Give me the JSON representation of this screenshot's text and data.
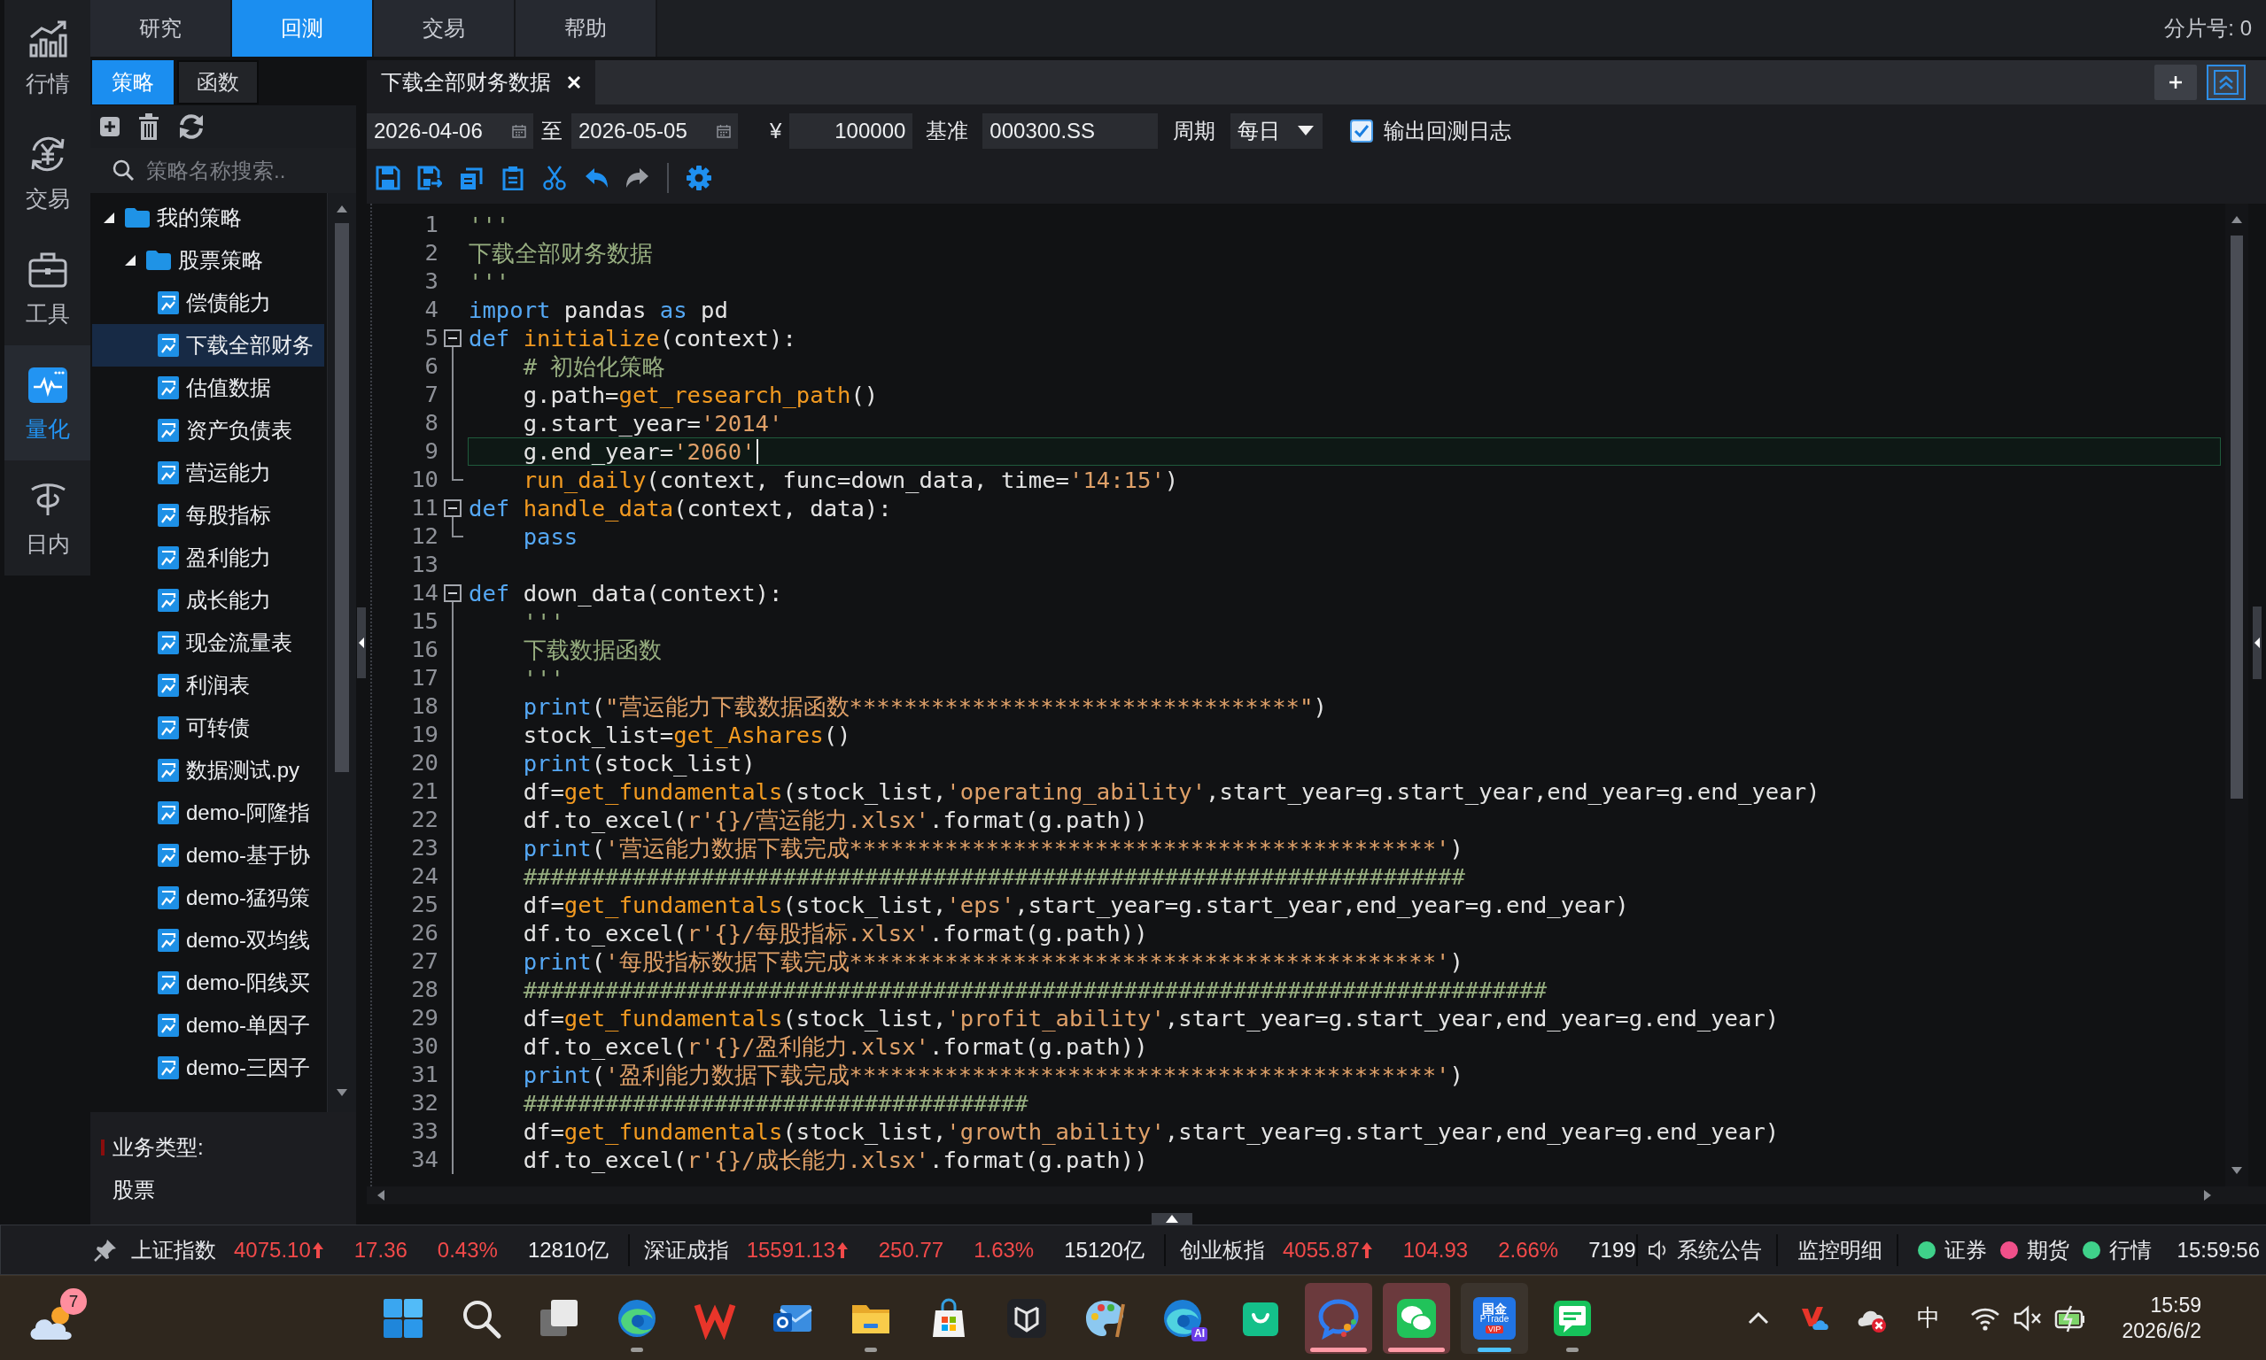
{
  "nav_rail": {
    "items": [
      {
        "label": "行情",
        "selected": false
      },
      {
        "label": "交易",
        "selected": false
      },
      {
        "label": "工具",
        "selected": false
      },
      {
        "label": "量化",
        "selected": true
      },
      {
        "label": "日内",
        "selected": false
      }
    ]
  },
  "top_tabs": [
    {
      "label": "研究",
      "selected": false
    },
    {
      "label": "回测",
      "selected": true
    },
    {
      "label": "交易",
      "selected": false
    },
    {
      "label": "帮助",
      "selected": false
    }
  ],
  "shard_label": "分片号: 0",
  "strategy_panel": {
    "tabs": [
      {
        "label": "策略",
        "selected": true
      },
      {
        "label": "函数",
        "selected": false
      }
    ],
    "search": {
      "placeholder": "策略名称搜索.."
    },
    "tree": [
      {
        "label": "我的策略",
        "kind": "folder",
        "expanded": true,
        "selected": false,
        "children": [
          {
            "label": "股票策略",
            "kind": "folder",
            "expanded": true,
            "selected": false,
            "children": [
              {
                "label": "偿债能力",
                "kind": "file",
                "selected": false
              },
              {
                "label": "下载全部财务",
                "kind": "file",
                "selected": true
              },
              {
                "label": "估值数据",
                "kind": "file",
                "selected": false
              },
              {
                "label": "资产负债表",
                "kind": "file",
                "selected": false
              },
              {
                "label": "营运能力",
                "kind": "file",
                "selected": false
              },
              {
                "label": "每股指标",
                "kind": "file",
                "selected": false
              },
              {
                "label": "盈利能力",
                "kind": "file",
                "selected": false
              },
              {
                "label": "成长能力",
                "kind": "file",
                "selected": false
              },
              {
                "label": "现金流量表",
                "kind": "file",
                "selected": false
              },
              {
                "label": "利润表",
                "kind": "file",
                "selected": false
              },
              {
                "label": "可转债",
                "kind": "file",
                "selected": false
              },
              {
                "label": "数据测试.py",
                "kind": "file",
                "selected": false
              },
              {
                "label": "demo-阿隆指",
                "kind": "file",
                "selected": false
              },
              {
                "label": "demo-基于协",
                "kind": "file",
                "selected": false
              },
              {
                "label": "demo-猛犸策",
                "kind": "file",
                "selected": false
              },
              {
                "label": "demo-双均线",
                "kind": "file",
                "selected": false
              },
              {
                "label": "demo-阳线买",
                "kind": "file",
                "selected": false
              },
              {
                "label": "demo-单因子",
                "kind": "file",
                "selected": false
              },
              {
                "label": "demo-三因子",
                "kind": "file",
                "selected": false
              }
            ]
          }
        ]
      }
    ],
    "info": {
      "label": "业务类型:",
      "value": "股票"
    }
  },
  "editor": {
    "tabs": [
      {
        "label": "下载全部财务数据",
        "selected": true
      }
    ],
    "params": {
      "start_date": "2026-04-06",
      "range_separator": "至",
      "end_date": "2026-05-05",
      "currency_symbol": "¥",
      "capital": "100000",
      "benchmark_label": "基准",
      "benchmark": "000300.SS",
      "period_label": "周期",
      "period": "每日",
      "log_option": {
        "label": "输出回测日志",
        "checked": true
      }
    },
    "lines": [
      {
        "number": "1",
        "current": false,
        "tokens": [
          {
            "kind": "comment",
            "text": "'''"
          }
        ]
      },
      {
        "number": "2",
        "current": false,
        "tokens": [
          {
            "kind": "comment",
            "text": "下载全部财务数据"
          }
        ]
      },
      {
        "number": "3",
        "current": false,
        "tokens": [
          {
            "kind": "comment",
            "text": "'''"
          }
        ]
      },
      {
        "number": "4",
        "current": false,
        "tokens": [
          {
            "kind": "keyword",
            "text": "import"
          },
          {
            "kind": "plain",
            "text": " pandas "
          },
          {
            "kind": "keyword",
            "text": "as"
          },
          {
            "kind": "plain",
            "text": " pd"
          }
        ]
      },
      {
        "number": "5",
        "current": false,
        "expanded": true,
        "tokens": [
          {
            "kind": "keyword",
            "text": "def "
          },
          {
            "kind": "function",
            "text": "initialize"
          },
          {
            "kind": "plain",
            "text": "(context):"
          }
        ],
        "children": [
          {
            "number": "6",
            "current": false,
            "tokens": [
              {
                "kind": "comment",
                "text": "# 初始化策略"
              }
            ]
          },
          {
            "number": "7",
            "current": false,
            "tokens": [
              {
                "kind": "plain",
                "text": "g.path="
              },
              {
                "kind": "function",
                "text": "get_research_path"
              },
              {
                "kind": "plain",
                "text": "()"
              }
            ]
          },
          {
            "number": "8",
            "current": false,
            "tokens": [
              {
                "kind": "plain",
                "text": "g.start_year="
              },
              {
                "kind": "string",
                "text": "'2014'"
              }
            ]
          },
          {
            "number": "9",
            "current": true,
            "tokens": [
              {
                "kind": "plain",
                "text": "g.end_year="
              },
              {
                "kind": "string",
                "text": "'2060'"
              }
            ]
          },
          {
            "number": "10",
            "current": false,
            "tokens": [
              {
                "kind": "function",
                "text": "run_daily"
              },
              {
                "kind": "plain",
                "text": "(context, func=down_data, time="
              },
              {
                "kind": "string",
                "text": "'14:15'"
              },
              {
                "kind": "plain",
                "text": ")"
              }
            ]
          }
        ]
      },
      {
        "number": "11",
        "current": false,
        "expanded": true,
        "tokens": [
          {
            "kind": "keyword",
            "text": "def "
          },
          {
            "kind": "function",
            "text": "handle_data"
          },
          {
            "kind": "plain",
            "text": "(context, data):"
          }
        ],
        "children": [
          {
            "number": "12",
            "current": false,
            "tokens": [
              {
                "kind": "keyword",
                "text": "pass"
              }
            ]
          }
        ]
      },
      {
        "number": "13",
        "current": false
      },
      {
        "number": "14",
        "current": false,
        "expanded": true,
        "tokens": [
          {
            "kind": "keyword",
            "text": "def "
          },
          {
            "kind": "plain",
            "text": "down_data(context):"
          }
        ],
        "children": [
          {
            "number": "15",
            "current": false,
            "tokens": [
              {
                "kind": "comment",
                "text": "'''"
              }
            ]
          },
          {
            "number": "16",
            "current": false,
            "tokens": [
              {
                "kind": "comment",
                "text": "下载数据函数"
              }
            ]
          },
          {
            "number": "17",
            "current": false,
            "tokens": [
              {
                "kind": "comment",
                "text": "'''"
              }
            ]
          },
          {
            "number": "18",
            "current": false,
            "tokens": [
              {
                "kind": "keyword",
                "text": "print"
              },
              {
                "kind": "plain",
                "text": "("
              },
              {
                "kind": "string",
                "text": "\"营运能力下载数据函数*********************************\""
              },
              {
                "kind": "plain",
                "text": ")"
              }
            ]
          },
          {
            "number": "19",
            "current": false,
            "tokens": [
              {
                "kind": "plain",
                "text": "stock_list="
              },
              {
                "kind": "function",
                "text": "get_Ashares"
              },
              {
                "kind": "plain",
                "text": "()"
              }
            ]
          },
          {
            "number": "20",
            "current": false,
            "tokens": [
              {
                "kind": "keyword",
                "text": "print"
              },
              {
                "kind": "plain",
                "text": "(stock_list)"
              }
            ]
          },
          {
            "number": "21",
            "current": false,
            "tokens": [
              {
                "kind": "plain",
                "text": "df="
              },
              {
                "kind": "function",
                "text": "get_fundamentals"
              },
              {
                "kind": "plain",
                "text": "(stock_list,"
              },
              {
                "kind": "string",
                "text": "'operating_ability'"
              },
              {
                "kind": "plain",
                "text": ",start_year=g.start_year,end_year=g.end_year)"
              }
            ]
          },
          {
            "number": "22",
            "current": false,
            "tokens": [
              {
                "kind": "plain",
                "text": "df.to_excel("
              },
              {
                "kind": "string",
                "text": "r'{}/营运能力.xlsx'"
              },
              {
                "kind": "plain",
                "text": ".format(g.path))"
              }
            ]
          },
          {
            "number": "23",
            "current": false,
            "tokens": [
              {
                "kind": "keyword",
                "text": "print"
              },
              {
                "kind": "plain",
                "text": "("
              },
              {
                "kind": "string",
                "text": "'营运能力数据下载完成*******************************************'"
              },
              {
                "kind": "plain",
                "text": ")"
              }
            ]
          },
          {
            "number": "24",
            "current": false,
            "tokens": [
              {
                "kind": "comment",
                "text": "#####################################################################"
              }
            ]
          },
          {
            "number": "25",
            "current": false,
            "tokens": [
              {
                "kind": "plain",
                "text": "df="
              },
              {
                "kind": "function",
                "text": "get_fundamentals"
              },
              {
                "kind": "plain",
                "text": "(stock_list,"
              },
              {
                "kind": "string",
                "text": "'eps'"
              },
              {
                "kind": "plain",
                "text": ",start_year=g.start_year,end_year=g.end_year)"
              }
            ]
          },
          {
            "number": "26",
            "current": false,
            "tokens": [
              {
                "kind": "plain",
                "text": "df.to_excel("
              },
              {
                "kind": "string",
                "text": "r'{}/每股指标.xlsx'"
              },
              {
                "kind": "plain",
                "text": ".format(g.path))"
              }
            ]
          },
          {
            "number": "27",
            "current": false,
            "tokens": [
              {
                "kind": "keyword",
                "text": "print"
              },
              {
                "kind": "plain",
                "text": "("
              },
              {
                "kind": "string",
                "text": "'每股指标数据下载完成*******************************************'"
              },
              {
                "kind": "plain",
                "text": ")"
              }
            ]
          },
          {
            "number": "28",
            "current": false,
            "tokens": [
              {
                "kind": "comment",
                "text": "###########################################################################"
              }
            ]
          },
          {
            "number": "29",
            "current": false,
            "tokens": [
              {
                "kind": "plain",
                "text": "df="
              },
              {
                "kind": "function",
                "text": "get_fundamentals"
              },
              {
                "kind": "plain",
                "text": "(stock_list,"
              },
              {
                "kind": "string",
                "text": "'profit_ability'"
              },
              {
                "kind": "plain",
                "text": ",start_year=g.start_year,end_year=g.end_year)"
              }
            ]
          },
          {
            "number": "30",
            "current": false,
            "tokens": [
              {
                "kind": "plain",
                "text": "df.to_excel("
              },
              {
                "kind": "string",
                "text": "r'{}/盈利能力.xlsx'"
              },
              {
                "kind": "plain",
                "text": ".format(g.path))"
              }
            ]
          },
          {
            "number": "31",
            "current": false,
            "tokens": [
              {
                "kind": "keyword",
                "text": "print"
              },
              {
                "kind": "plain",
                "text": "("
              },
              {
                "kind": "string",
                "text": "'盈利能力数据下载完成*******************************************'"
              },
              {
                "kind": "plain",
                "text": ")"
              }
            ]
          },
          {
            "number": "32",
            "current": false,
            "tokens": [
              {
                "kind": "comment",
                "text": "#####################################"
              }
            ]
          },
          {
            "number": "33",
            "current": false,
            "tokens": [
              {
                "kind": "plain",
                "text": "df="
              },
              {
                "kind": "function",
                "text": "get_fundamentals"
              },
              {
                "kind": "plain",
                "text": "(stock_list,"
              },
              {
                "kind": "string",
                "text": "'growth_ability'"
              },
              {
                "kind": "plain",
                "text": ",start_year=g.start_year,end_year=g.end_year)"
              }
            ]
          },
          {
            "number": "34",
            "current": false,
            "tokens": [
              {
                "kind": "plain",
                "text": "df.to_excel("
              },
              {
                "kind": "string",
                "text": "r'{}/成长能力.xlsx'"
              },
              {
                "kind": "plain",
                "text": ".format(g.path))"
              }
            ]
          }
        ]
      }
    ]
  },
  "status_bar": {
    "indices": [
      {
        "name": "上证指数",
        "value": "4075.10",
        "rising": true,
        "change": "17.36",
        "percent": "0.43%",
        "turnover": "12810亿"
      },
      {
        "name": "深证成指",
        "value": "15591.13",
        "rising": true,
        "change": "250.77",
        "percent": "1.63%",
        "turnover": "15120亿"
      },
      {
        "name": "创业板指",
        "value": "4055.87",
        "rising": true,
        "change": "104.93",
        "percent": "2.66%",
        "turnover": "7199"
      }
    ],
    "notice": "系统公告",
    "monitor": "监控明细",
    "connections": [
      {
        "label": "证券",
        "color": "#3fd18a"
      },
      {
        "label": "期货",
        "color": "#f0508a"
      },
      {
        "label": "行情",
        "color": "#3fd18a"
      }
    ],
    "time": "15:59:56"
  },
  "taskbar": {
    "weather": {
      "badge": "7"
    },
    "apps": [
      {
        "open": false,
        "flashing": false,
        "selected": false
      },
      {
        "open": false,
        "flashing": false,
        "selected": false
      },
      {
        "open": false,
        "flashing": false,
        "selected": false
      },
      {
        "open": true,
        "flashing": false,
        "selected": false
      },
      {
        "open": false,
        "flashing": false,
        "selected": false
      },
      {
        "open": false,
        "flashing": false,
        "selected": false
      },
      {
        "open": true,
        "flashing": false,
        "selected": false
      },
      {
        "open": false,
        "flashing": false,
        "selected": false
      },
      {
        "open": false,
        "flashing": false,
        "selected": false
      },
      {
        "open": false,
        "flashing": false,
        "selected": false
      },
      {
        "open": false,
        "flashing": false,
        "selected": false,
        "badge": "AI"
      },
      {
        "open": false,
        "flashing": false,
        "selected": false
      },
      {
        "open": true,
        "flashing": true,
        "selected": false
      },
      {
        "open": true,
        "flashing": true,
        "selected": false
      },
      {
        "open": true,
        "flashing": false,
        "selected": true,
        "logo_text": [
          "国金",
          "PTrade",
          "VIP"
        ]
      },
      {
        "open": true,
        "flashing": false,
        "selected": false
      }
    ],
    "tray": {
      "input_mode": "中"
    },
    "clock": {
      "time": "15:59",
      "date": "2026/6/2"
    }
  }
}
